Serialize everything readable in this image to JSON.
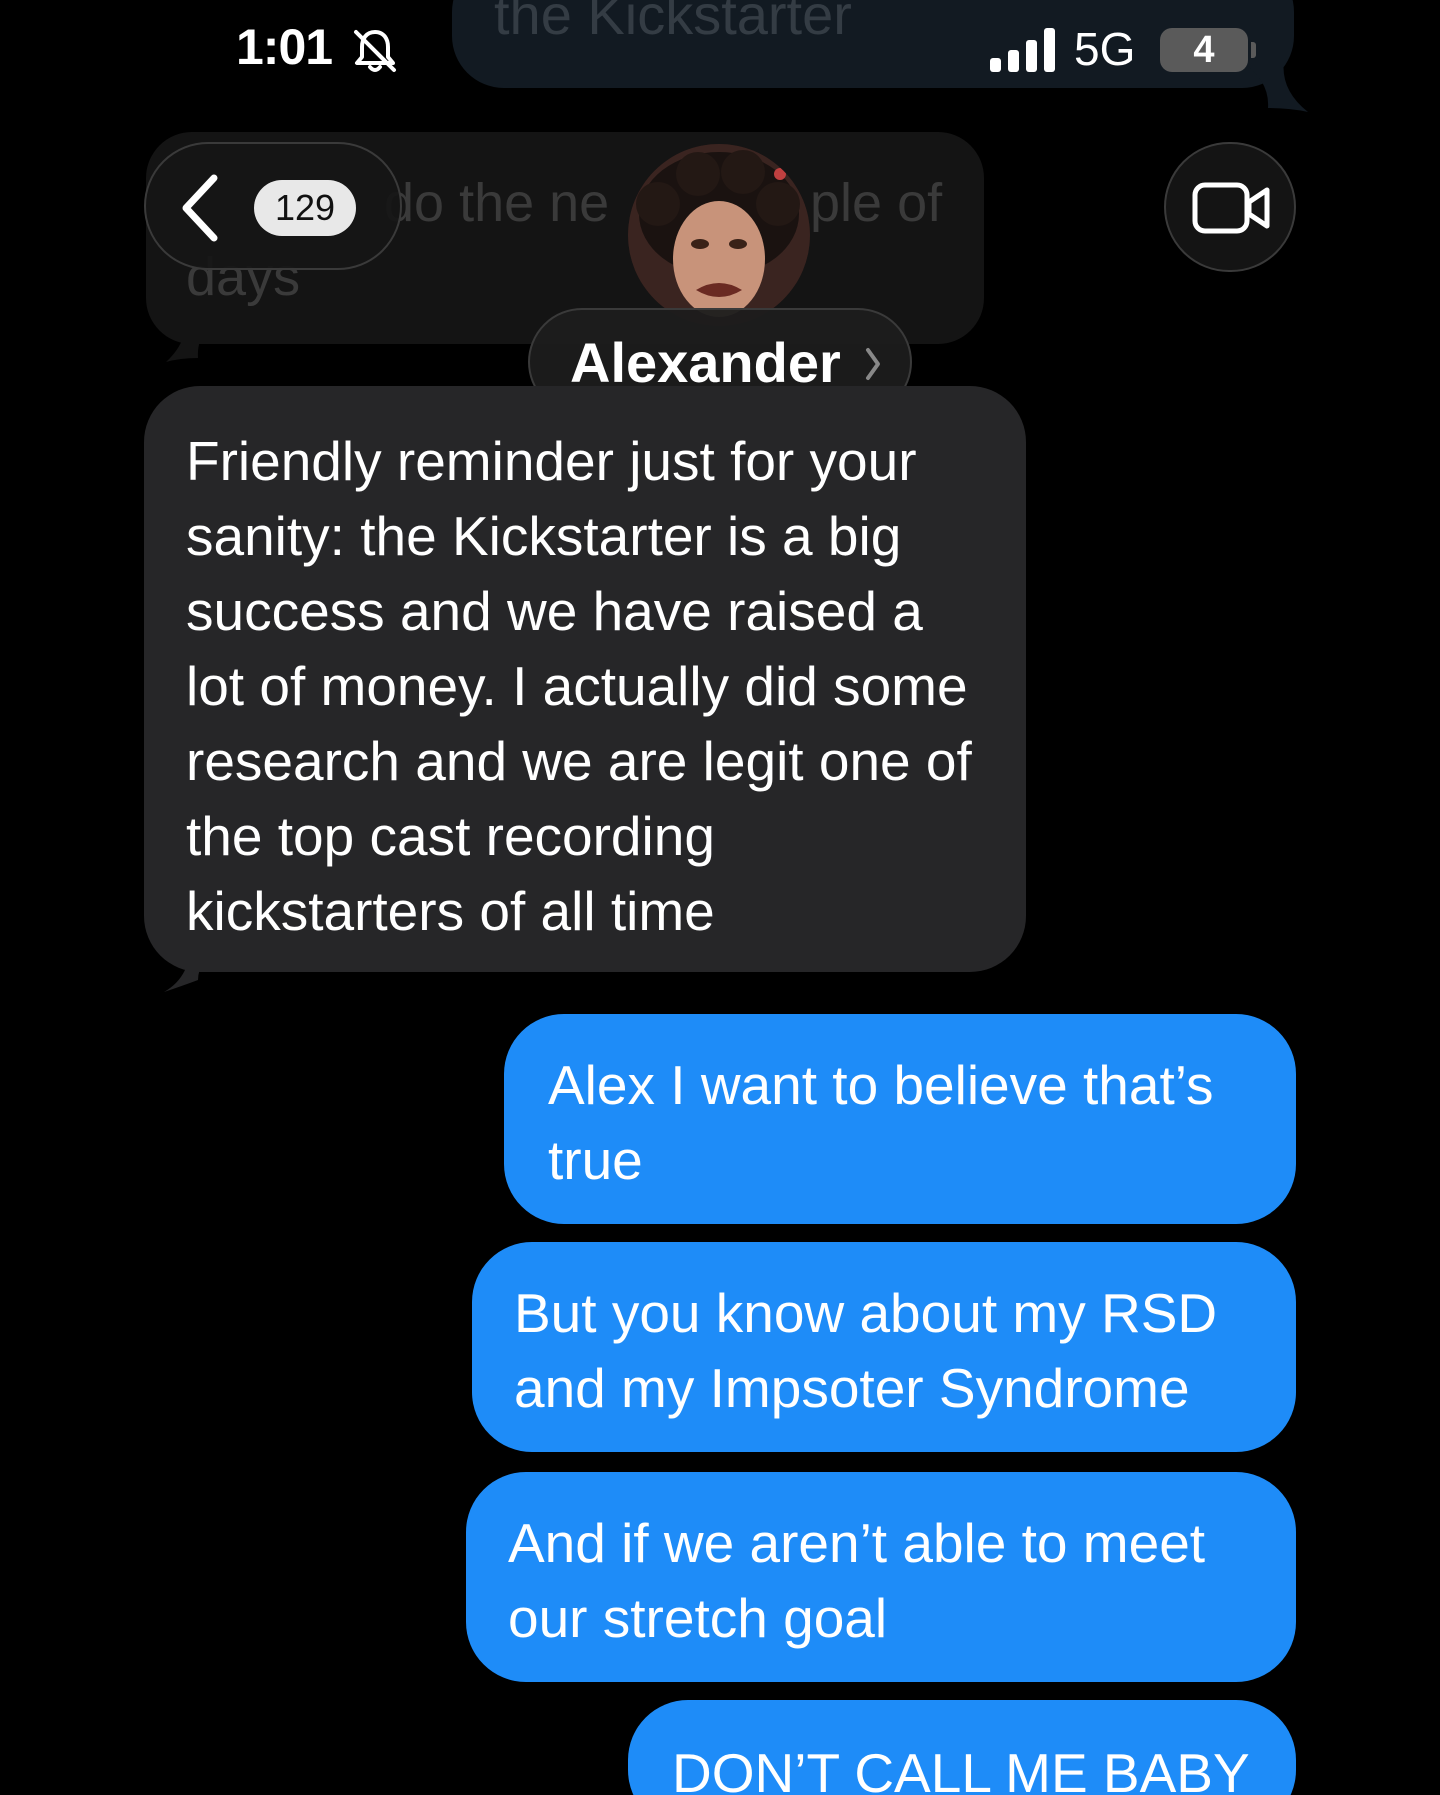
{
  "status_bar": {
    "time": "1:01",
    "network": "5G",
    "battery": "4"
  },
  "ghost_messages": {
    "top_sent": "the Kickstarter",
    "received_line1_left": "do the ne",
    "received_line1_right": "ple of",
    "received_line2": "days"
  },
  "header": {
    "back_count": "129",
    "contact_name": "Alexander"
  },
  "messages": [
    {
      "direction": "incoming",
      "text": "Friendly reminder just for your sanity: the Kickstarter is a big success and we have raised a lot of money. I actually did some research and we are legit one of the top cast recording kickstarters of all time"
    },
    {
      "direction": "outgoing",
      "text": "Alex I want to believe that’s true"
    },
    {
      "direction": "outgoing",
      "text": "But you know about my RSD and my Impsoter Syndrome"
    },
    {
      "direction": "outgoing",
      "text": "And if we aren’t able to meet our stretch goal"
    },
    {
      "direction": "outgoing",
      "text": "DON’T CALL ME BABY"
    }
  ],
  "colors": {
    "outgoing_bubble": "#1e8cf8",
    "incoming_bubble": "#262628",
    "background": "#000000"
  },
  "icons": [
    "bell-slash-icon",
    "signal-bars-icon",
    "chevron-left-icon",
    "video-camera-icon",
    "chevron-right-icon"
  ]
}
